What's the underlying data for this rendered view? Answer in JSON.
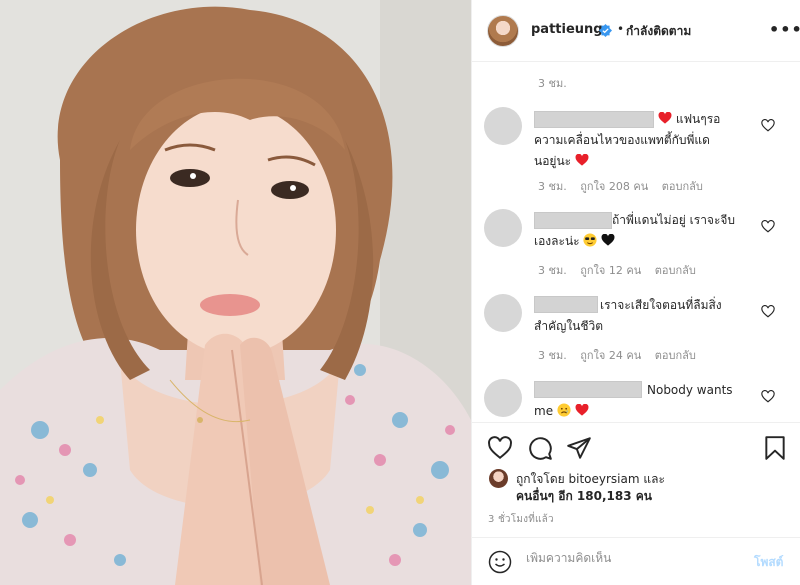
{
  "post": {
    "username": "pattieung",
    "separator": "•",
    "follow_status": "กำลังติดตาม",
    "more_label": "•••"
  },
  "comments": {
    "top_time": "3 ชม.",
    "items": [
      {
        "text_lines": [
          "แฟนๆรอ",
          "ความเคลื่อนไหวของแพทตี้กับพี่แด",
          "นอยู่นะ"
        ],
        "time": "3 ชม.",
        "likes": "ถูกใจ 208 คน",
        "reply": "ตอบกลับ"
      },
      {
        "text_lines": [
          "ถ้าพี่แดนไม่อยู่ เราจะจีบ",
          "เองละน่ะ"
        ],
        "time": "3 ชม.",
        "likes": "ถูกใจ 12 คน",
        "reply": "ตอบกลับ"
      },
      {
        "text_lines": [
          "เราจะเสียใจตอนที่ลืมสิ่ง",
          "สำคัญในชีวิต"
        ],
        "time": "3 ชม.",
        "likes": "ถูกใจ 24 คน",
        "reply": "ตอบกลับ"
      },
      {
        "text_lines": [
          "Nobody wants",
          "me"
        ]
      }
    ]
  },
  "likes": {
    "line1": "ถูกใจโดย bitoeyrsiam และ",
    "line2": "คนอื่นๆ อีก 180,183 คน"
  },
  "posted_ago": "3 ชั่วโมงที่แล้ว",
  "compose": {
    "placeholder": "เพิ่มความคิดเห็น",
    "post_label": "โพสต์"
  },
  "colors": {
    "verified": "#3897f0",
    "heart": "#ed4956",
    "post_disabled": "#b3dbff"
  },
  "icons": [
    "verified-icon",
    "heart-icon",
    "comment-icon",
    "share-icon",
    "bookmark-icon",
    "smile-icon"
  ]
}
